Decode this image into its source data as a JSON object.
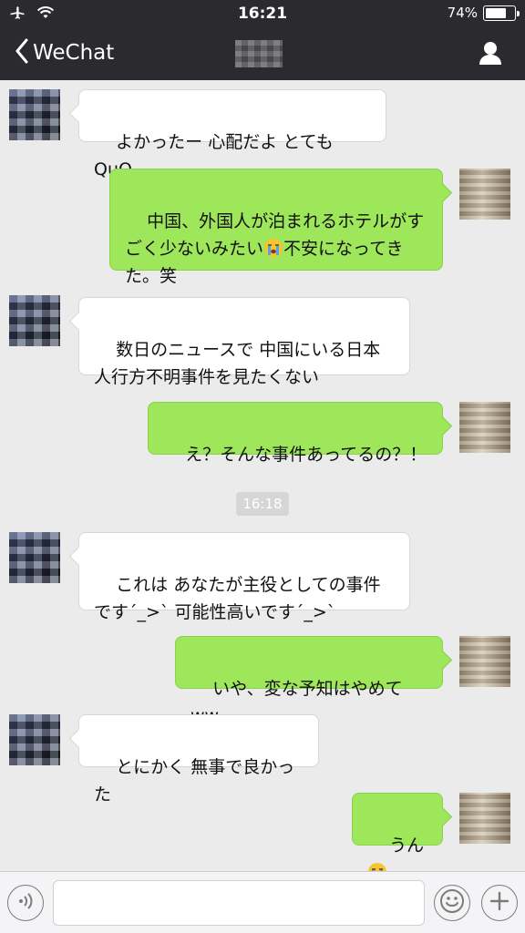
{
  "status_bar": {
    "time": "16:21",
    "battery_percent": "74%",
    "battery_level": 0.74,
    "icons": [
      "airplane-icon",
      "wifi-icon",
      "battery-icon"
    ]
  },
  "nav": {
    "back_label": "WeChat",
    "back_icon": "chevron-left-icon",
    "profile_icon": "profile-icon"
  },
  "colors": {
    "header_bg": "#2b2b2f",
    "chat_bg": "#ebebeb",
    "incoming_bubble": "#ffffff",
    "outgoing_bubble": "#9ee65a"
  },
  "messages": [
    {
      "side": "left",
      "text": "よかったー 心配だよ とてもQuQ"
    },
    {
      "side": "right",
      "text_before": "中国、外国人が泊まれるホテルがすごく少ないみたい",
      "emoji": "crying-face-icon",
      "text_after": "不安になってきた。笑"
    },
    {
      "side": "left",
      "text": "数日のニュースで 中国にいる日本人行方不明事件を見たくない"
    },
    {
      "side": "right",
      "text": "え？そんな事件あってるの？！"
    },
    {
      "side": "left",
      "text": "これは あなたが主役としての事件です´_>` 可能性高いです´_>`"
    },
    {
      "side": "right",
      "text": "いや、変な予知はやめてww"
    },
    {
      "side": "left",
      "text": "とにかく 無事で良かった"
    },
    {
      "side": "right",
      "text": "うん",
      "emoji": "crying-face-icon"
    }
  ],
  "timestamp_divider": "16:18",
  "input_bar": {
    "voice_icon": "voice-icon",
    "emoji_icon": "emoji-icon",
    "plus_icon": "plus-icon"
  }
}
